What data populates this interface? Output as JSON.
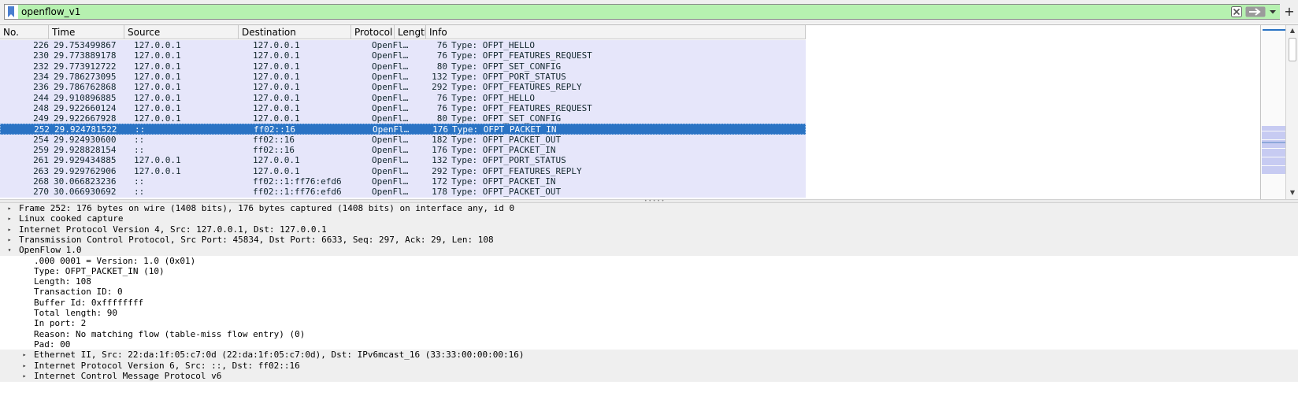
{
  "filter": {
    "text": "openflow_v1",
    "bookmark_icon": "bookmark-icon",
    "clear_icon": "clear-icon",
    "apply_icon": "arrow-right-icon",
    "dropdown_icon": "chevron-down-icon",
    "add_label": "+",
    "colors": {
      "valid_bg": "#b6f1b0"
    }
  },
  "packet_list": {
    "columns": [
      "No.",
      "Time",
      "Source",
      "Destination",
      "Protocol",
      "Length",
      "Info"
    ],
    "colors": {
      "row_bg": "#e6e6fa",
      "selected_bg": "#2a73c4"
    },
    "rows": [
      {
        "no": "226",
        "time": "29.753499867",
        "source": "127.0.0.1",
        "destination": "127.0.0.1",
        "protocol": "OpenFl…",
        "length": "76",
        "info": "Type: OFPT_HELLO"
      },
      {
        "no": "230",
        "time": "29.773889178",
        "source": "127.0.0.1",
        "destination": "127.0.0.1",
        "protocol": "OpenFl…",
        "length": "76",
        "info": "Type: OFPT_FEATURES_REQUEST"
      },
      {
        "no": "232",
        "time": "29.773912722",
        "source": "127.0.0.1",
        "destination": "127.0.0.1",
        "protocol": "OpenFl…",
        "length": "80",
        "info": "Type: OFPT_SET_CONFIG"
      },
      {
        "no": "234",
        "time": "29.786273095",
        "source": "127.0.0.1",
        "destination": "127.0.0.1",
        "protocol": "OpenFl…",
        "length": "132",
        "info": "Type: OFPT_PORT_STATUS"
      },
      {
        "no": "236",
        "time": "29.786762868",
        "source": "127.0.0.1",
        "destination": "127.0.0.1",
        "protocol": "OpenFl…",
        "length": "292",
        "info": "Type: OFPT_FEATURES_REPLY"
      },
      {
        "no": "244",
        "time": "29.910896885",
        "source": "127.0.0.1",
        "destination": "127.0.0.1",
        "protocol": "OpenFl…",
        "length": "76",
        "info": "Type: OFPT_HELLO"
      },
      {
        "no": "248",
        "time": "29.922660124",
        "source": "127.0.0.1",
        "destination": "127.0.0.1",
        "protocol": "OpenFl…",
        "length": "76",
        "info": "Type: OFPT_FEATURES_REQUEST"
      },
      {
        "no": "249",
        "time": "29.922667928",
        "source": "127.0.0.1",
        "destination": "127.0.0.1",
        "protocol": "OpenFl…",
        "length": "80",
        "info": "Type: OFPT_SET_CONFIG"
      },
      {
        "no": "252",
        "time": "29.924781522",
        "source": "::",
        "destination": "ff02::16",
        "protocol": "OpenFl…",
        "length": "176",
        "info": "Type: OFPT_PACKET_IN",
        "selected": true
      },
      {
        "no": "254",
        "time": "29.924930600",
        "source": "::",
        "destination": "ff02::16",
        "protocol": "OpenFl…",
        "length": "182",
        "info": "Type: OFPT_PACKET_OUT"
      },
      {
        "no": "259",
        "time": "29.928828154",
        "source": "::",
        "destination": "ff02::16",
        "protocol": "OpenFl…",
        "length": "176",
        "info": "Type: OFPT_PACKET_IN"
      },
      {
        "no": "261",
        "time": "29.929434885",
        "source": "127.0.0.1",
        "destination": "127.0.0.1",
        "protocol": "OpenFl…",
        "length": "132",
        "info": "Type: OFPT_PORT_STATUS"
      },
      {
        "no": "263",
        "time": "29.929762906",
        "source": "127.0.0.1",
        "destination": "127.0.0.1",
        "protocol": "OpenFl…",
        "length": "292",
        "info": "Type: OFPT_FEATURES_REPLY"
      },
      {
        "no": "268",
        "time": "30.066823236",
        "source": "::",
        "destination": "ff02::1:ff76:efd6",
        "protocol": "OpenFl…",
        "length": "172",
        "info": "Type: OFPT_PACKET_IN"
      },
      {
        "no": "270",
        "time": "30.066930692",
        "source": "::",
        "destination": "ff02::1:ff76:efd6",
        "protocol": "OpenFl…",
        "length": "178",
        "info": "Type: OFPT_PACKET_OUT"
      }
    ]
  },
  "details": {
    "lines": [
      {
        "text": "Frame 252: 176 bytes on wire (1408 bits), 176 bytes captured (1408 bits) on interface any, id 0",
        "level": 0,
        "expander": "collapsed"
      },
      {
        "text": "Linux cooked capture",
        "level": 0,
        "expander": "collapsed"
      },
      {
        "text": "Internet Protocol Version 4, Src: 127.0.0.1, Dst: 127.0.0.1",
        "level": 0,
        "expander": "collapsed"
      },
      {
        "text": "Transmission Control Protocol, Src Port: 45834, Dst Port: 6633, Seq: 297, Ack: 29, Len: 108",
        "level": 0,
        "expander": "collapsed"
      },
      {
        "text": "OpenFlow 1.0",
        "level": 0,
        "expander": "expanded"
      },
      {
        "text": ".000 0001 = Version: 1.0 (0x01)",
        "level": 1,
        "expander": "none"
      },
      {
        "text": "Type: OFPT_PACKET_IN (10)",
        "level": 1,
        "expander": "none"
      },
      {
        "text": "Length: 108",
        "level": 1,
        "expander": "none"
      },
      {
        "text": "Transaction ID: 0",
        "level": 1,
        "expander": "none"
      },
      {
        "text": "Buffer Id: 0xffffffff",
        "level": 1,
        "expander": "none"
      },
      {
        "text": "Total length: 90",
        "level": 1,
        "expander": "none"
      },
      {
        "text": "In port: 2",
        "level": 1,
        "expander": "none"
      },
      {
        "text": "Reason: No matching flow (table-miss flow entry) (0)",
        "level": 1,
        "expander": "none"
      },
      {
        "text": "Pad: 00",
        "level": 1,
        "expander": "none"
      },
      {
        "text": "Ethernet II, Src: 22:da:1f:05:c7:0d (22:da:1f:05:c7:0d), Dst: IPv6mcast_16 (33:33:00:00:00:16)",
        "level": 1,
        "expander": "collapsed"
      },
      {
        "text": "Internet Protocol Version 6, Src: ::, Dst: ff02::16",
        "level": 1,
        "expander": "collapsed"
      },
      {
        "text": "Internet Control Message Protocol v6",
        "level": 1,
        "expander": "collapsed"
      }
    ]
  }
}
